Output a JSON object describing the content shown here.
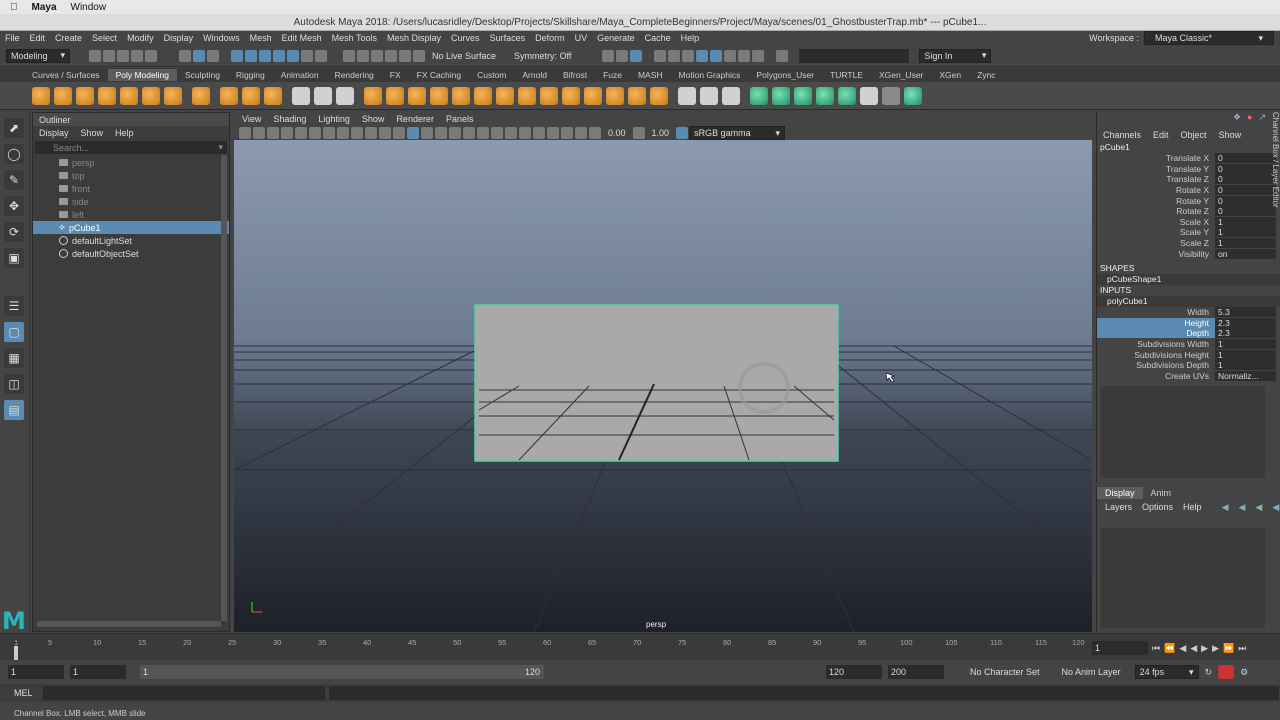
{
  "mac": {
    "app": "Maya",
    "menu": [
      "Window"
    ]
  },
  "titlebar": {
    "text": "Autodesk Maya 2018: /Users/lucasridley/Desktop/Projects/Skillshare/Maya_CompleteBeginners/Project/Maya/scenes/01_GhostbusterTrap.mb*  ---  pCube1..."
  },
  "menubar": [
    "File",
    "Edit",
    "Create",
    "Select",
    "Modify",
    "Display",
    "Windows",
    "Mesh",
    "Edit Mesh",
    "Mesh Tools",
    "Mesh Display",
    "Curves",
    "Surfaces",
    "Deform",
    "UV",
    "Generate",
    "Cache",
    "Help"
  ],
  "workspace": {
    "label": "Workspace :",
    "value": "Maya Classic*"
  },
  "statusline": {
    "menuset": "Modeling",
    "live_surface": "No Live Surface",
    "symmetry": "Symmetry: Off",
    "sign_in": "Sign In"
  },
  "shelf_tabs": [
    "Curves / Surfaces",
    "Poly Modeling",
    "Sculpting",
    "Rigging",
    "Animation",
    "Rendering",
    "FX",
    "FX Caching",
    "Custom",
    "Arnold",
    "Bifrost",
    "Fuze",
    "MASH",
    "Motion Graphics",
    "Polygons_User",
    "TURTLE",
    "XGen_User",
    "XGen",
    "Zync"
  ],
  "shelf_active": "Poly Modeling",
  "outliner": {
    "title": "Outliner",
    "menu": [
      "Display",
      "Show",
      "Help"
    ],
    "search_placeholder": "Search...",
    "items": [
      {
        "label": "persp",
        "dim": true
      },
      {
        "label": "top",
        "dim": true
      },
      {
        "label": "front",
        "dim": true
      },
      {
        "label": "side",
        "dim": true
      },
      {
        "label": "left",
        "dim": true
      },
      {
        "label": "pCube1",
        "selected": true
      },
      {
        "label": "defaultLightSet"
      },
      {
        "label": "defaultObjectSet"
      }
    ]
  },
  "viewport": {
    "menu": [
      "View",
      "Shading",
      "Lighting",
      "Show",
      "Renderer",
      "Panels"
    ],
    "exposure": "0.00",
    "gamma": "1.00",
    "colorspace": "sRGB gamma",
    "camera": "persp"
  },
  "channelbox": {
    "menu": [
      "Channels",
      "Edit",
      "Object",
      "Show"
    ],
    "object": "pCube1",
    "attrs": [
      {
        "k": "Translate X",
        "v": "0"
      },
      {
        "k": "Translate Y",
        "v": "0"
      },
      {
        "k": "Translate Z",
        "v": "0"
      },
      {
        "k": "Rotate X",
        "v": "0"
      },
      {
        "k": "Rotate Y",
        "v": "0"
      },
      {
        "k": "Rotate Z",
        "v": "0"
      },
      {
        "k": "Scale X",
        "v": "1"
      },
      {
        "k": "Scale Y",
        "v": "1"
      },
      {
        "k": "Scale Z",
        "v": "1"
      },
      {
        "k": "Visibility",
        "v": "on"
      }
    ],
    "shapes_label": "SHAPES",
    "shape": "pCubeShape1",
    "inputs_label": "INPUTS",
    "input": "polyCube1",
    "input_attrs": [
      {
        "k": "Width",
        "v": "5.3"
      },
      {
        "k": "Height",
        "v": "2.3",
        "hl": true
      },
      {
        "k": "Depth",
        "v": "2.3",
        "hl": true
      },
      {
        "k": "Subdivisions Width",
        "v": "1"
      },
      {
        "k": "Subdivisions Height",
        "v": "1"
      },
      {
        "k": "Subdivisions Depth",
        "v": "1"
      },
      {
        "k": "Create UVs",
        "v": "Normaliz..."
      }
    ],
    "side_tab": "Channel Box / Layer Editor"
  },
  "layers": {
    "tabs": [
      "Display",
      "Anim"
    ],
    "menu": [
      "Layers",
      "Options",
      "Help"
    ]
  },
  "timeline": {
    "ticks": [
      "5",
      "10",
      "15",
      "20",
      "25",
      "30",
      "35",
      "40",
      "45",
      "50",
      "55",
      "60",
      "65",
      "70",
      "75",
      "80",
      "85",
      "90",
      "95",
      "100",
      "105",
      "110",
      "115",
      "120"
    ],
    "start_label": "1",
    "current": "1"
  },
  "range": {
    "start": "1",
    "anim_start": "1",
    "slider_start": "1",
    "slider_end": "120",
    "end": "120",
    "anim_end": "200",
    "char_set": "No Character Set",
    "anim_layer": "No Anim Layer",
    "fps": "24 fps"
  },
  "cmd": {
    "label": "MEL"
  },
  "help": {
    "text": "Channel Box: LMB select, MMB slide"
  }
}
